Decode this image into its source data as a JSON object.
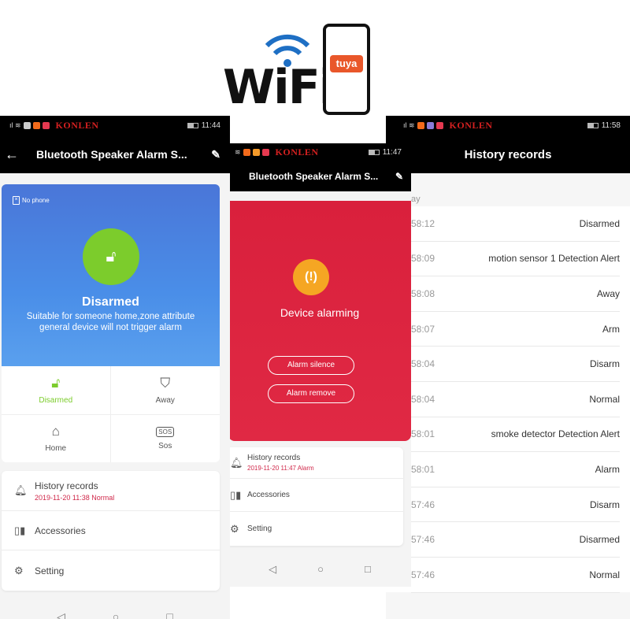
{
  "logo": {
    "wordmark": "WiFi",
    "badge": "tuya"
  },
  "brand": "KONLEN",
  "colors": {
    "blue": "#4a86e8",
    "green": "#7ccc2c",
    "red": "#dc2340",
    "orange": "#f5a623",
    "alert_text": "#d0284a"
  },
  "screen1": {
    "time": "11:44",
    "title": "Bluetooth Speaker Alarm S...",
    "no_phone": "No phone",
    "status_title": "Disarmed",
    "status_desc_1": "Suitable for someone home,zone attribute",
    "status_desc_2": "general device will not trigger alarm",
    "modes": [
      {
        "label": "Disarmed",
        "icon": "unlock-icon",
        "active": true
      },
      {
        "label": "Away",
        "icon": "shield-check-icon"
      },
      {
        "label": "Home",
        "icon": "home-icon"
      },
      {
        "label": "Sos",
        "icon": "sos-icon"
      }
    ],
    "menu": [
      {
        "label": "History records",
        "sub": "2019-11-20 11:38 Normal",
        "icon": "bell-icon"
      },
      {
        "label": "Accessories",
        "icon": "accessories-icon"
      },
      {
        "label": "Setting",
        "icon": "gear-icon"
      }
    ]
  },
  "screen2": {
    "time": "11:47",
    "title": "Bluetooth Speaker Alarm S...",
    "status_title": "Device alarming",
    "buttons": {
      "silence": "Alarm silence",
      "remove": "Alarm remove"
    },
    "menu": [
      {
        "label": "History records",
        "sub": "2019-11-20 11:47 Alarm",
        "icon": "bell-icon"
      },
      {
        "label": "Accessories",
        "icon": "accessories-icon"
      },
      {
        "label": "Setting",
        "icon": "gear-icon"
      }
    ]
  },
  "screen3": {
    "time": "11:58",
    "title": "History records",
    "section": "ay",
    "records": [
      {
        "time": "58:12",
        "event": "Disarmed"
      },
      {
        "time": "58:09",
        "event": "motion sensor 1 Detection Alert"
      },
      {
        "time": "58:08",
        "event": "Away"
      },
      {
        "time": "58:07",
        "event": "Arm"
      },
      {
        "time": "58:04",
        "event": "Disarm"
      },
      {
        "time": "58:04",
        "event": "Normal"
      },
      {
        "time": "58:01",
        "event": "smoke  detector Detection Alert"
      },
      {
        "time": "58:01",
        "event": "Alarm"
      },
      {
        "time": "57:46",
        "event": "Disarm"
      },
      {
        "time": "57:46",
        "event": "Disarmed"
      },
      {
        "time": "57:46",
        "event": "Normal"
      }
    ]
  }
}
